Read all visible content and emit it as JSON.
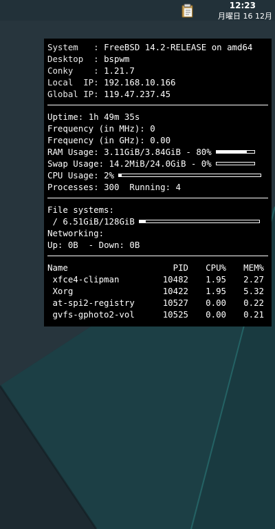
{
  "topbar": {
    "time": "12:23",
    "date": "月曜日 16 12月",
    "tray_icon": "clipboard-icon"
  },
  "system": {
    "rows": [
      {
        "label": "System   : ",
        "value": "FreeBSD 14.2-RELEASE on amd64"
      },
      {
        "label": "Desktop  : ",
        "value": "bspwm"
      },
      {
        "label": "Conky    : ",
        "value": "1.21.7"
      },
      {
        "label": "Local  IP: ",
        "value": "192.168.10.166"
      },
      {
        "label": "Global IP: ",
        "value": "119.47.237.45"
      }
    ]
  },
  "stats": {
    "uptime": {
      "label": "Uptime: ",
      "value": "1h 49m 35s"
    },
    "freq_mhz": {
      "label": "Frequency (in MHz): ",
      "value": "0"
    },
    "freq_ghz": {
      "label": "Frequency (in GHz): ",
      "value": "0.00"
    },
    "ram": {
      "label": "RAM Usage: ",
      "value": "3.11GiB/3.84GiB - 80%",
      "percent": 80
    },
    "swap": {
      "label": "Swap Usage: ",
      "value": "14.2MiB/24.0GiB - 0%",
      "percent": 0
    },
    "cpu": {
      "label": "CPU Usage: ",
      "value": "2%",
      "percent": 2
    },
    "processes": {
      "label": "Processes: ",
      "value": "300",
      "running_label": "  Running: ",
      "running_value": "4"
    }
  },
  "filesystems": {
    "title": "File systems:",
    "root": {
      "label": " / ",
      "value": "6.51GiB/128GiB",
      "percent": 5
    },
    "networking_title": "Networking:",
    "up_label": "Up: ",
    "up_value": "0B",
    "down_label": "  - Down: ",
    "down_value": "0B"
  },
  "processes": {
    "headers": {
      "name": "Name",
      "pid": "PID",
      "cpu": "CPU%",
      "mem": "MEM%"
    },
    "rows": [
      {
        "name": " xfce4-clipman",
        "pid": "10482",
        "cpu": "1.95",
        "mem": "2.27"
      },
      {
        "name": " Xorg",
        "pid": "10422",
        "cpu": "1.95",
        "mem": "5.32"
      },
      {
        "name": " at-spi2-registry",
        "pid": "10527",
        "cpu": "0.00",
        "mem": "0.22"
      },
      {
        "name": " gvfs-gphoto2-vol",
        "pid": "10525",
        "cpu": "0.00",
        "mem": "0.21"
      }
    ]
  },
  "colors": {
    "accent": "#1b5e63",
    "panel": "#000000",
    "wallpaper": "#213038"
  }
}
